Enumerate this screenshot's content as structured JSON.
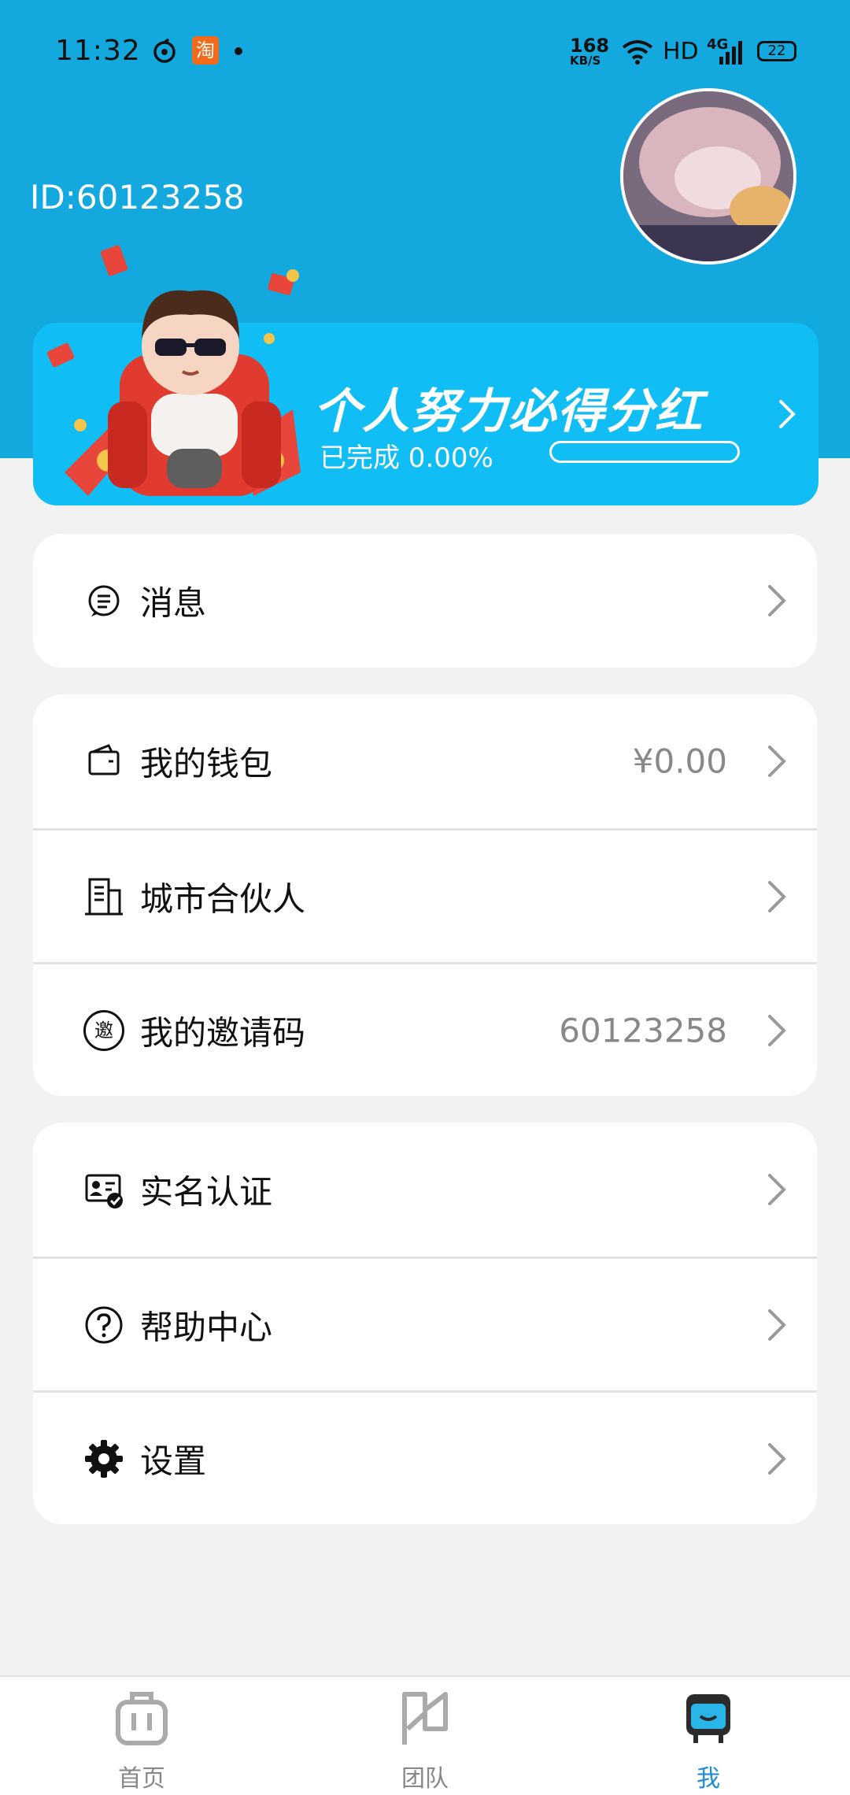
{
  "status_bar": {
    "time": "11:32",
    "net_speed_value": "168",
    "net_speed_unit": "KB/S",
    "hd_label": "HD",
    "network_label": "4G",
    "battery": "22",
    "taobao_glyph": "淘"
  },
  "profile": {
    "id_text": "ID:60123258"
  },
  "banner": {
    "title": "个人努力必得分红",
    "progress_text": "已完成 0.00%",
    "progress_fraction": 0.0
  },
  "menu": {
    "message": {
      "label": "消息"
    },
    "wallet": {
      "label": "我的钱包",
      "value": "¥0.00"
    },
    "city_partner": {
      "label": "城市合伙人"
    },
    "invite_code": {
      "label": "我的邀请码",
      "value": "60123258",
      "icon_glyph": "邀"
    },
    "verification": {
      "label": "实名认证"
    },
    "help": {
      "label": "帮助中心"
    },
    "settings": {
      "label": "设置"
    }
  },
  "tabbar": {
    "home": {
      "label": "首页"
    },
    "team": {
      "label": "团队"
    },
    "me": {
      "label": "我"
    }
  },
  "colors": {
    "header": "#13a9df",
    "banner": "#10bdf4",
    "active_tab": "#1a8fd6"
  }
}
